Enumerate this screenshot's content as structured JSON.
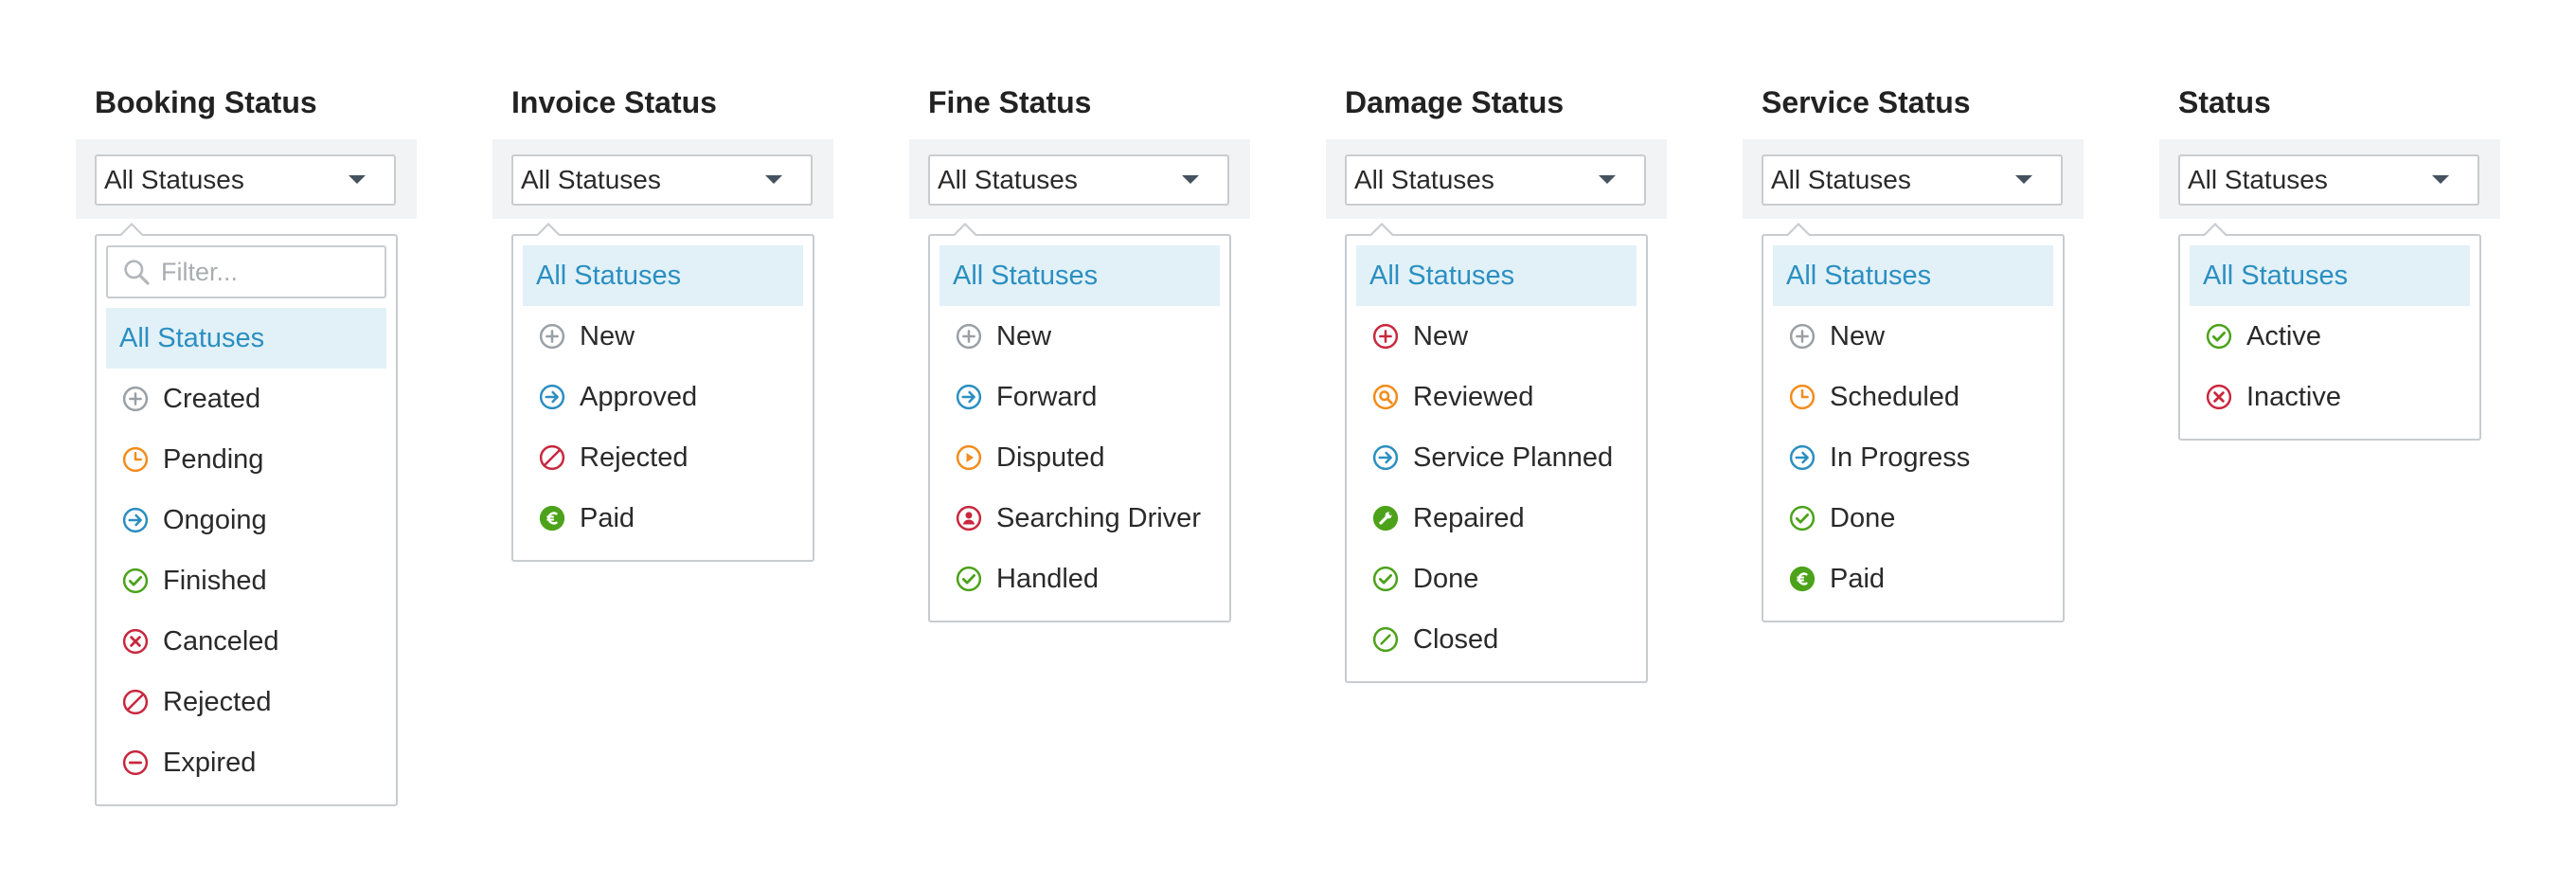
{
  "colors": {
    "gray": "#9aa0a6",
    "orange": "#f28c1c",
    "blue": "#2b8fc1",
    "green": "#4ca21a",
    "red": "#c8283e",
    "selected_bg": "#e2f1f8"
  },
  "columns": [
    {
      "title": "Booking Status",
      "selected": "All Statuses",
      "filter_placeholder": "Filter...",
      "options": [
        {
          "label": "All Statuses",
          "icon": "",
          "active": true
        },
        {
          "label": "Created",
          "icon": "plus-circle-icon",
          "color": "#9aa0a6"
        },
        {
          "label": "Pending",
          "icon": "clock-icon",
          "color": "#f28c1c"
        },
        {
          "label": "Ongoing",
          "icon": "arrow-circle-icon",
          "color": "#2b8fc1"
        },
        {
          "label": "Finished",
          "icon": "check-circle-icon",
          "color": "#4ca21a"
        },
        {
          "label": "Canceled",
          "icon": "x-circle-icon",
          "color": "#c8283e"
        },
        {
          "label": "Rejected",
          "icon": "ban-icon",
          "color": "#c8283e"
        },
        {
          "label": "Expired",
          "icon": "minus-circle-icon",
          "color": "#c8283e"
        }
      ]
    },
    {
      "title": "Invoice Status",
      "selected": "All Statuses",
      "options": [
        {
          "label": "All Statuses",
          "icon": "",
          "active": true
        },
        {
          "label": "New",
          "icon": "plus-circle-icon",
          "color": "#9aa0a6"
        },
        {
          "label": "Approved",
          "icon": "arrow-circle-icon",
          "color": "#2b8fc1"
        },
        {
          "label": "Rejected",
          "icon": "ban-icon",
          "color": "#c8283e"
        },
        {
          "label": "Paid",
          "icon": "euro-icon",
          "color": "#4ca21a"
        }
      ]
    },
    {
      "title": "Fine Status",
      "selected": "All Statuses",
      "options": [
        {
          "label": "All Statuses",
          "icon": "",
          "active": true
        },
        {
          "label": "New",
          "icon": "plus-circle-icon",
          "color": "#9aa0a6"
        },
        {
          "label": "Forward",
          "icon": "arrow-circle-icon",
          "color": "#2b8fc1"
        },
        {
          "label": "Disputed",
          "icon": "play-circle-icon",
          "color": "#f28c1c"
        },
        {
          "label": "Searching Driver",
          "icon": "user-circle-icon",
          "color": "#c8283e"
        },
        {
          "label": "Handled",
          "icon": "check-circle-icon",
          "color": "#4ca21a"
        }
      ]
    },
    {
      "title": "Damage Status",
      "selected": "All Statuses",
      "options": [
        {
          "label": "All Statuses",
          "icon": "",
          "active": true
        },
        {
          "label": "New",
          "icon": "plus-circle-icon",
          "color": "#c8283e"
        },
        {
          "label": "Reviewed",
          "icon": "magnifier-icon",
          "color": "#f28c1c"
        },
        {
          "label": "Service Planned",
          "icon": "arrow-circle-icon",
          "color": "#2b8fc1"
        },
        {
          "label": "Repaired",
          "icon": "wrench-icon",
          "color": "#4ca21a"
        },
        {
          "label": "Done",
          "icon": "check-circle-icon",
          "color": "#4ca21a"
        },
        {
          "label": "Closed",
          "icon": "slash-circle-icon",
          "color": "#4ca21a"
        }
      ]
    },
    {
      "title": "Service Status",
      "selected": "All Statuses",
      "options": [
        {
          "label": "All Statuses",
          "icon": "",
          "active": true
        },
        {
          "label": "New",
          "icon": "plus-circle-icon",
          "color": "#9aa0a6"
        },
        {
          "label": "Scheduled",
          "icon": "clock-icon",
          "color": "#f28c1c"
        },
        {
          "label": "In Progress",
          "icon": "arrow-circle-icon",
          "color": "#2b8fc1"
        },
        {
          "label": "Done",
          "icon": "check-circle-icon",
          "color": "#4ca21a"
        },
        {
          "label": "Paid",
          "icon": "euro-icon",
          "color": "#4ca21a"
        }
      ]
    },
    {
      "title": "Status",
      "selected": "All Statuses",
      "options": [
        {
          "label": "All Statuses",
          "icon": "",
          "active": true
        },
        {
          "label": "Active",
          "icon": "check-circle-icon",
          "color": "#4ca21a"
        },
        {
          "label": "Inactive",
          "icon": "x-circle-icon",
          "color": "#c8283e"
        }
      ]
    }
  ]
}
